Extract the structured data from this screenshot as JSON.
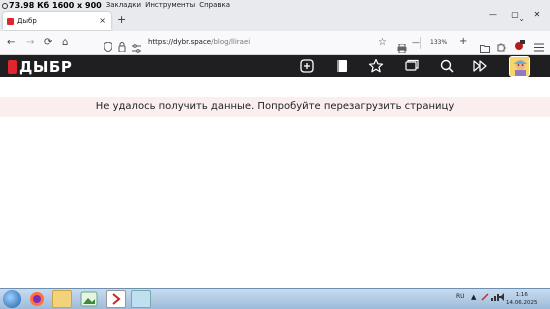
{
  "menubar": {
    "overlay_text": "73.98 Кб 1600 x 900",
    "items": [
      "Закладки",
      "Инструменты",
      "Справка"
    ]
  },
  "tab": {
    "title": "Дыбр",
    "close": "×"
  },
  "newtab": "+",
  "window_controls": {
    "minimize": "—",
    "maximize": "▢",
    "close": "✕"
  },
  "nav": {
    "back": "←",
    "forward": "→",
    "reload": "⟳",
    "home": "⌂",
    "url_host": "https://dybr.space",
    "url_path": "/blog/lliraei",
    "zoom_out": "—",
    "zoom": "133%",
    "zoom_in": "+"
  },
  "site": {
    "logo_text": "ДЫБР"
  },
  "error": {
    "message": "Не удалось получить данные. Попробуйте перезагрузить страницу"
  },
  "taskbar": {
    "lang": "RU",
    "time": "1:16",
    "date": "14.06.2025"
  },
  "colors": {
    "accent": "#e0262c",
    "header_bg": "#1f1f22",
    "error_bg": "#fbeeee"
  }
}
